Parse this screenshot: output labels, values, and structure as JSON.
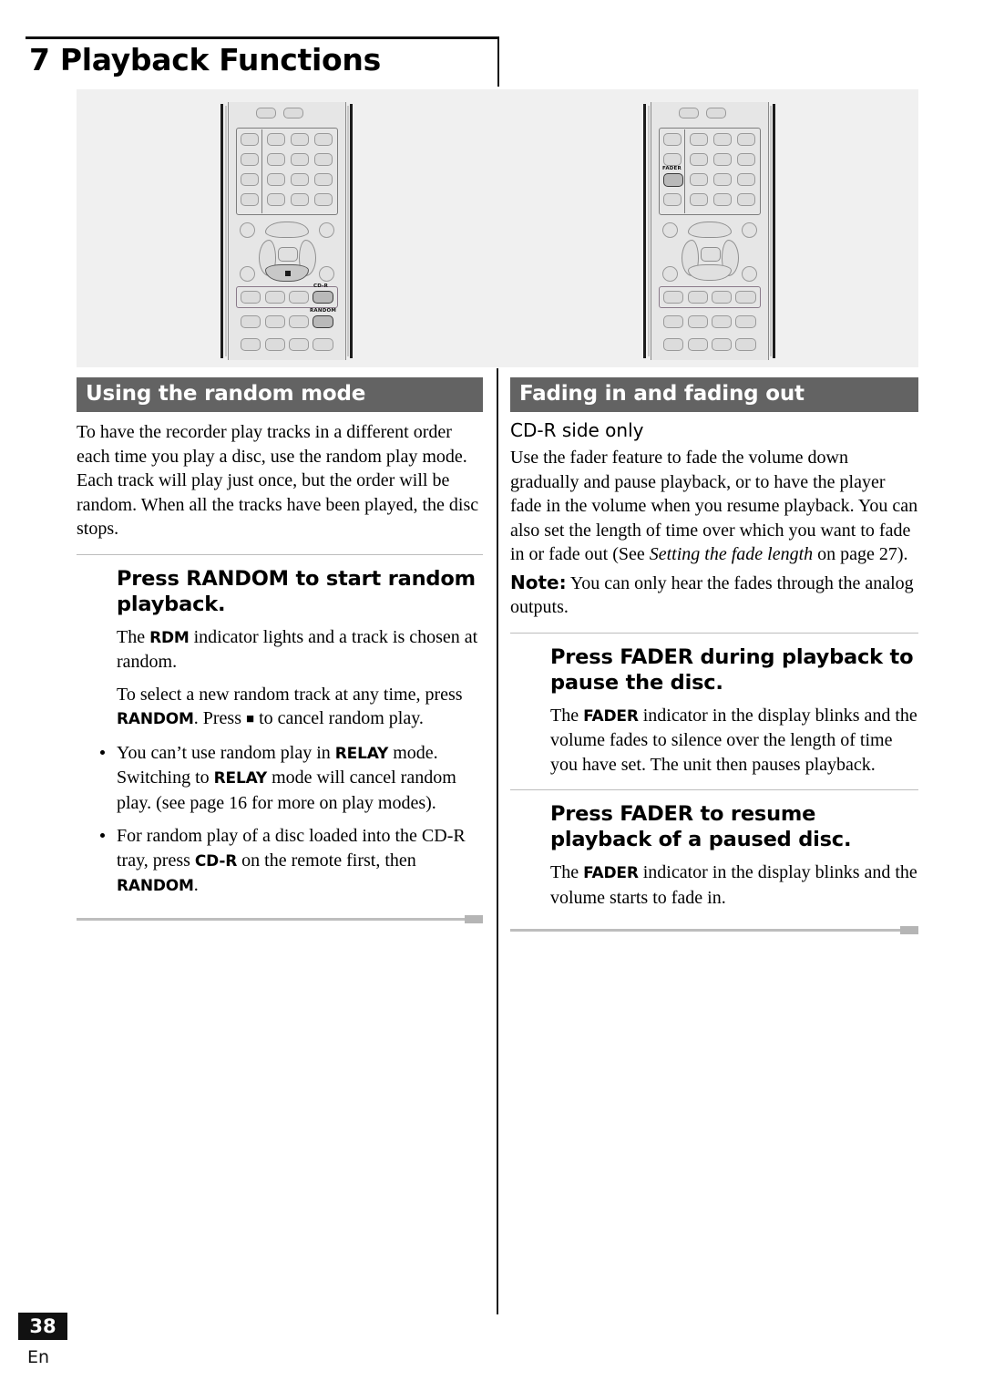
{
  "page": {
    "chapter_title": "7 Playback Functions",
    "page_number": "38",
    "language_code": "En"
  },
  "illustration": {
    "left_remote": {
      "name": "remote-control-random",
      "labels": [
        "CD-R",
        "RANDOM"
      ],
      "highlighted_buttons": [
        "CD-R",
        "RANDOM"
      ],
      "stop_glyph": "■"
    },
    "right_remote": {
      "name": "remote-control-fader",
      "labels": [
        "FADER"
      ],
      "highlighted_buttons": [
        "FADER"
      ]
    }
  },
  "left_column": {
    "section_title": "Using the random mode",
    "intro": "To have the recorder play tracks in a different order each time you play a disc, use the random play mode. Each track will play just once, but the order will be random. When all the tracks have been played, the disc stops.",
    "subsection": {
      "heading": "Press RANDOM to start random playback.",
      "body_lead": "The ",
      "body_kw": "RDM",
      "body_rest": " indicator lights and a track is chosen at random.",
      "para2_a": "To select a new random track at any time, press ",
      "para2_kw": "RANDOM",
      "para2_b": ". Press ",
      "para2_glyph": "■",
      "para2_c": " to cancel random play."
    },
    "bullets": [
      {
        "a": "You can’t use random play in ",
        "kw1": "RELAY",
        "b": " mode. Switching to ",
        "kw2": "RELAY",
        "c": " mode will cancel random play. (see page 16 for more on play modes)."
      },
      {
        "a": "For random play of a disc loaded into the CD-R tray, press ",
        "kw1": "CD-R",
        "b": " on the remote first, then ",
        "kw2": "RANDOM",
        "c": "."
      }
    ]
  },
  "right_column": {
    "section_title": "Fading in and fading out",
    "side_note": "CD-R side only",
    "intro_a": "Use the fader feature to fade the volume down gradually and pause playback, or to have the player fade in the volume when you resume playback. You can also set the length of time over which you want to fade in or fade out (See ",
    "intro_italic": "Setting the fade length",
    "intro_b": " on page 27).",
    "note_label": "Note:",
    "note_text": " You can only hear the fades through the analog outputs.",
    "subsections": [
      {
        "heading": "Press FADER during playback to pause the disc.",
        "lead": "The ",
        "kw": "FADER",
        "rest": " indicator in the display blinks and the volume fades to silence over the length of time you have set. The unit then pauses playback."
      },
      {
        "heading": "Press FADER to resume playback of a paused disc.",
        "lead": "The ",
        "kw": "FADER",
        "rest": " indicator in the display blinks and the volume starts to fade in."
      }
    ]
  },
  "colors": {
    "section_bar": "#636363",
    "illustration_bg": "#f0f0f0",
    "rule": "#bdbdbd",
    "badge": "#111111"
  }
}
